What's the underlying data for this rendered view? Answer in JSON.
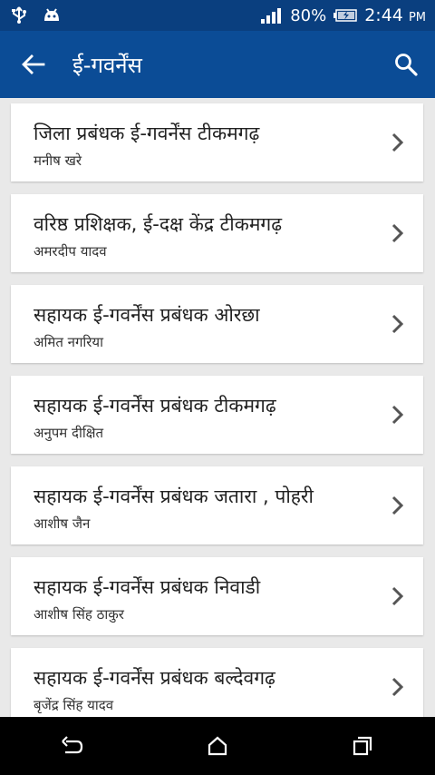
{
  "status_bar": {
    "battery": "80%",
    "time": "2:44",
    "ampm": "PM",
    "icons": [
      "usb-icon",
      "android-icon",
      "signal-icon",
      "battery-icon"
    ]
  },
  "app_bar": {
    "title": "ई-गवर्नेंस",
    "icons": [
      "back-arrow-icon",
      "search-icon"
    ]
  },
  "items": [
    {
      "title": "जिला प्रबंधक ई-गवर्नेंस टीकमगढ़",
      "subtitle": "मनीष खरे"
    },
    {
      "title": "वरिष्ठ प्रशिक्षक, ई-दक्ष केंद्र टीकमगढ़",
      "subtitle": "अमरदीप यादव"
    },
    {
      "title": "सहायक ई-गवर्नेंस प्रबंधक ओरछा",
      "subtitle": "अमित नगरिया"
    },
    {
      "title": "सहायक ई-गवर्नेंस प्रबंधक टीकमगढ़",
      "subtitle": "अनुपम दीक्षित"
    },
    {
      "title": "सहायक ई-गवर्नेंस प्रबंधक जतारा , पोहरी",
      "subtitle": "आशीष जैन"
    },
    {
      "title": "सहायक ई-गवर्नेंस प्रबंधक निवाडी",
      "subtitle": "आशीष सिंह ठाकुर"
    },
    {
      "title": "सहायक ई-गवर्नेंस प्रबंधक बल्देवगढ़",
      "subtitle": "बृजेंद्र सिंह यादव"
    }
  ],
  "nav_bar": {
    "icons": [
      "back-icon",
      "home-icon",
      "recents-icon"
    ]
  },
  "colors": {
    "status_bar": "#0a3f7f",
    "app_bar": "#0b4c96",
    "background": "#e9e9e9",
    "card": "#ffffff"
  }
}
